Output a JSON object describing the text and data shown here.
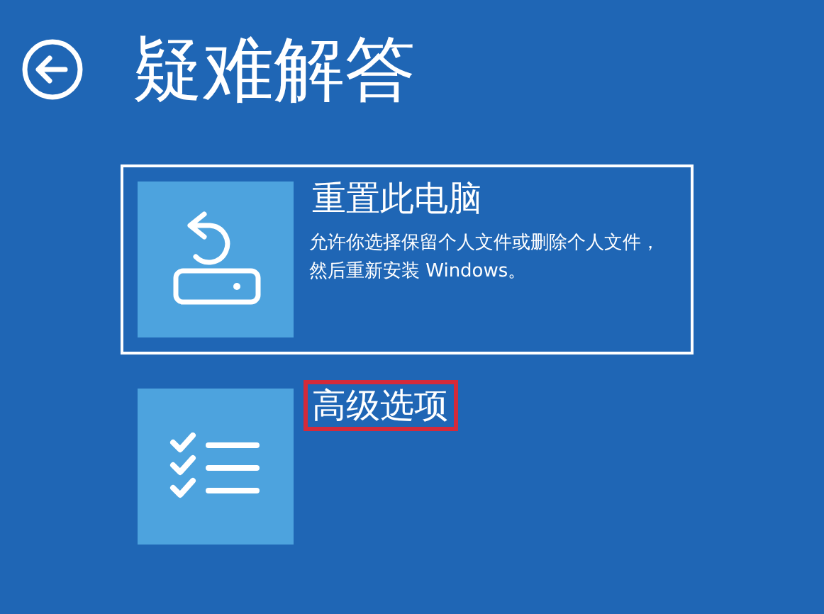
{
  "title": "疑难解答",
  "options": [
    {
      "kind": "reset",
      "title": "重置此电脑",
      "description": "允许你选择保留个人文件或删除个人文件，然后重新安装 Windows。",
      "selected": true,
      "highlighted": false
    },
    {
      "kind": "advanced",
      "title": "高级选项",
      "selected": false,
      "highlighted": true
    }
  ]
}
